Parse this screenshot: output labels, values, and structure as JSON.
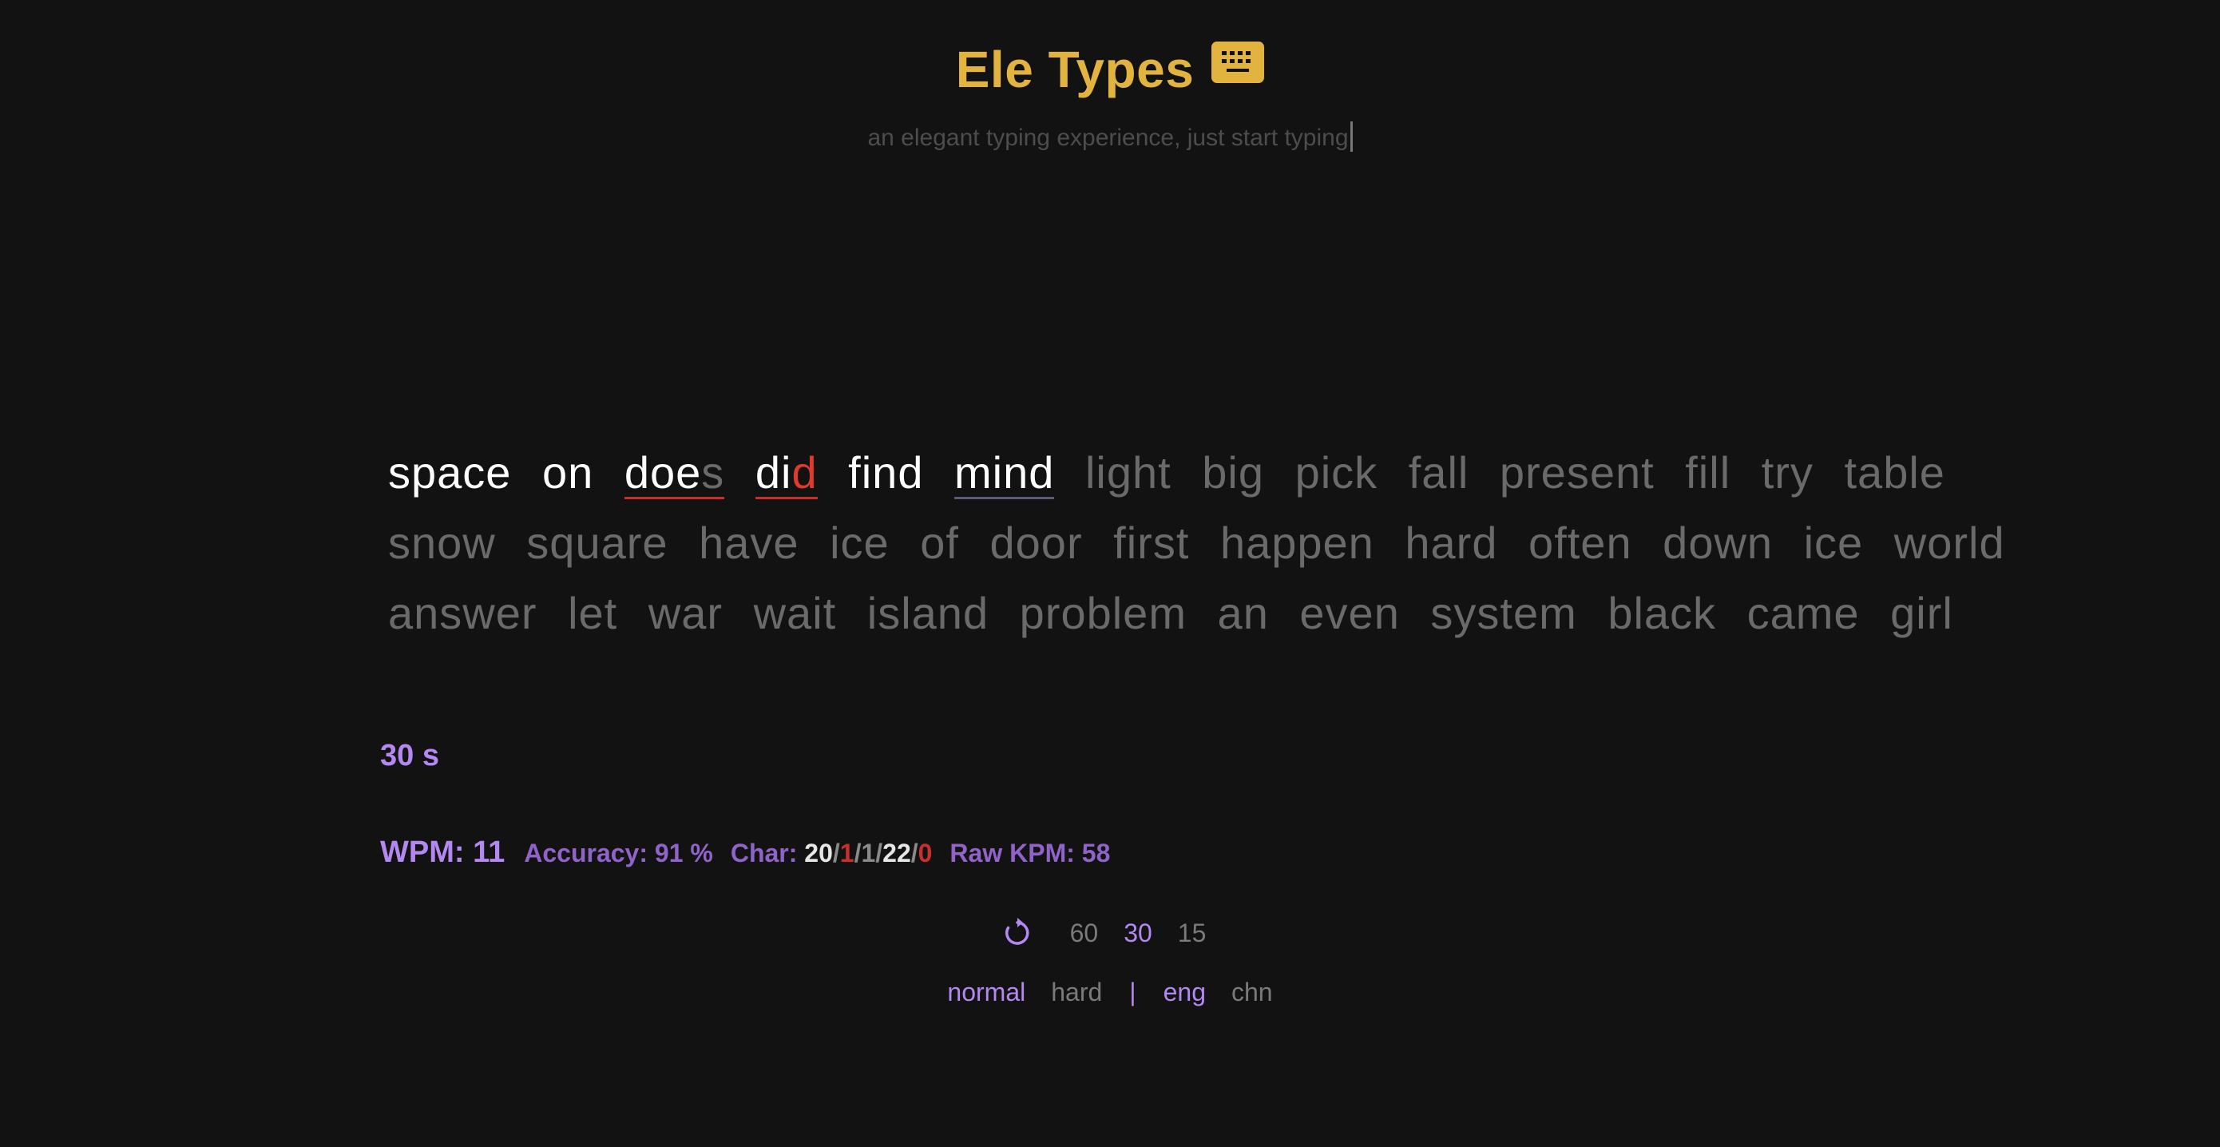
{
  "header": {
    "title": "Ele Types",
    "subtitle": "an elegant typing experience, just start typing"
  },
  "words": {
    "line1": {
      "w1": "space",
      "w2": "on",
      "w3_typed": "doe",
      "w3_missing": "s",
      "w4_typed": "di",
      "w4_wrong": "d",
      "w5": "find",
      "w6": "mind",
      "w7": "light",
      "w8": "big",
      "w9": "pick",
      "w10": "fall",
      "w11": "present",
      "w12": "fill",
      "w13": "try",
      "w14": "table"
    },
    "line2": [
      "snow",
      "square",
      "have",
      "ice",
      "of",
      "door",
      "first",
      "happen",
      "hard",
      "often",
      "down",
      "ice",
      "world"
    ],
    "line3": [
      "answer",
      "let",
      "war",
      "wait",
      "island",
      "problem",
      "an",
      "even",
      "system",
      "black",
      "came",
      "girl"
    ]
  },
  "timer": "30 s",
  "stats": {
    "wpm": "WPM: 11",
    "accuracy": "Accuracy: 91 %",
    "char_label": "Char: ",
    "char_correct": "20",
    "char_incorrect": "1",
    "char_extra": "1",
    "char_total": "22",
    "char_missed": "0",
    "slash": "/",
    "raw_kpm": "Raw KPM: 58"
  },
  "controls": {
    "durations": [
      "60",
      "30",
      "15"
    ],
    "active_duration": "30"
  },
  "modes": {
    "difficulty": [
      "normal",
      "hard"
    ],
    "separator": "|",
    "language": [
      "eng",
      "chn"
    ]
  },
  "colors": {
    "accent": "#b388f0",
    "title": "#e2b33f",
    "error": "#c9302c",
    "background": "#121212"
  },
  "icons": {
    "title_icon": "keyboard-icon",
    "restart": "restart-icon"
  }
}
